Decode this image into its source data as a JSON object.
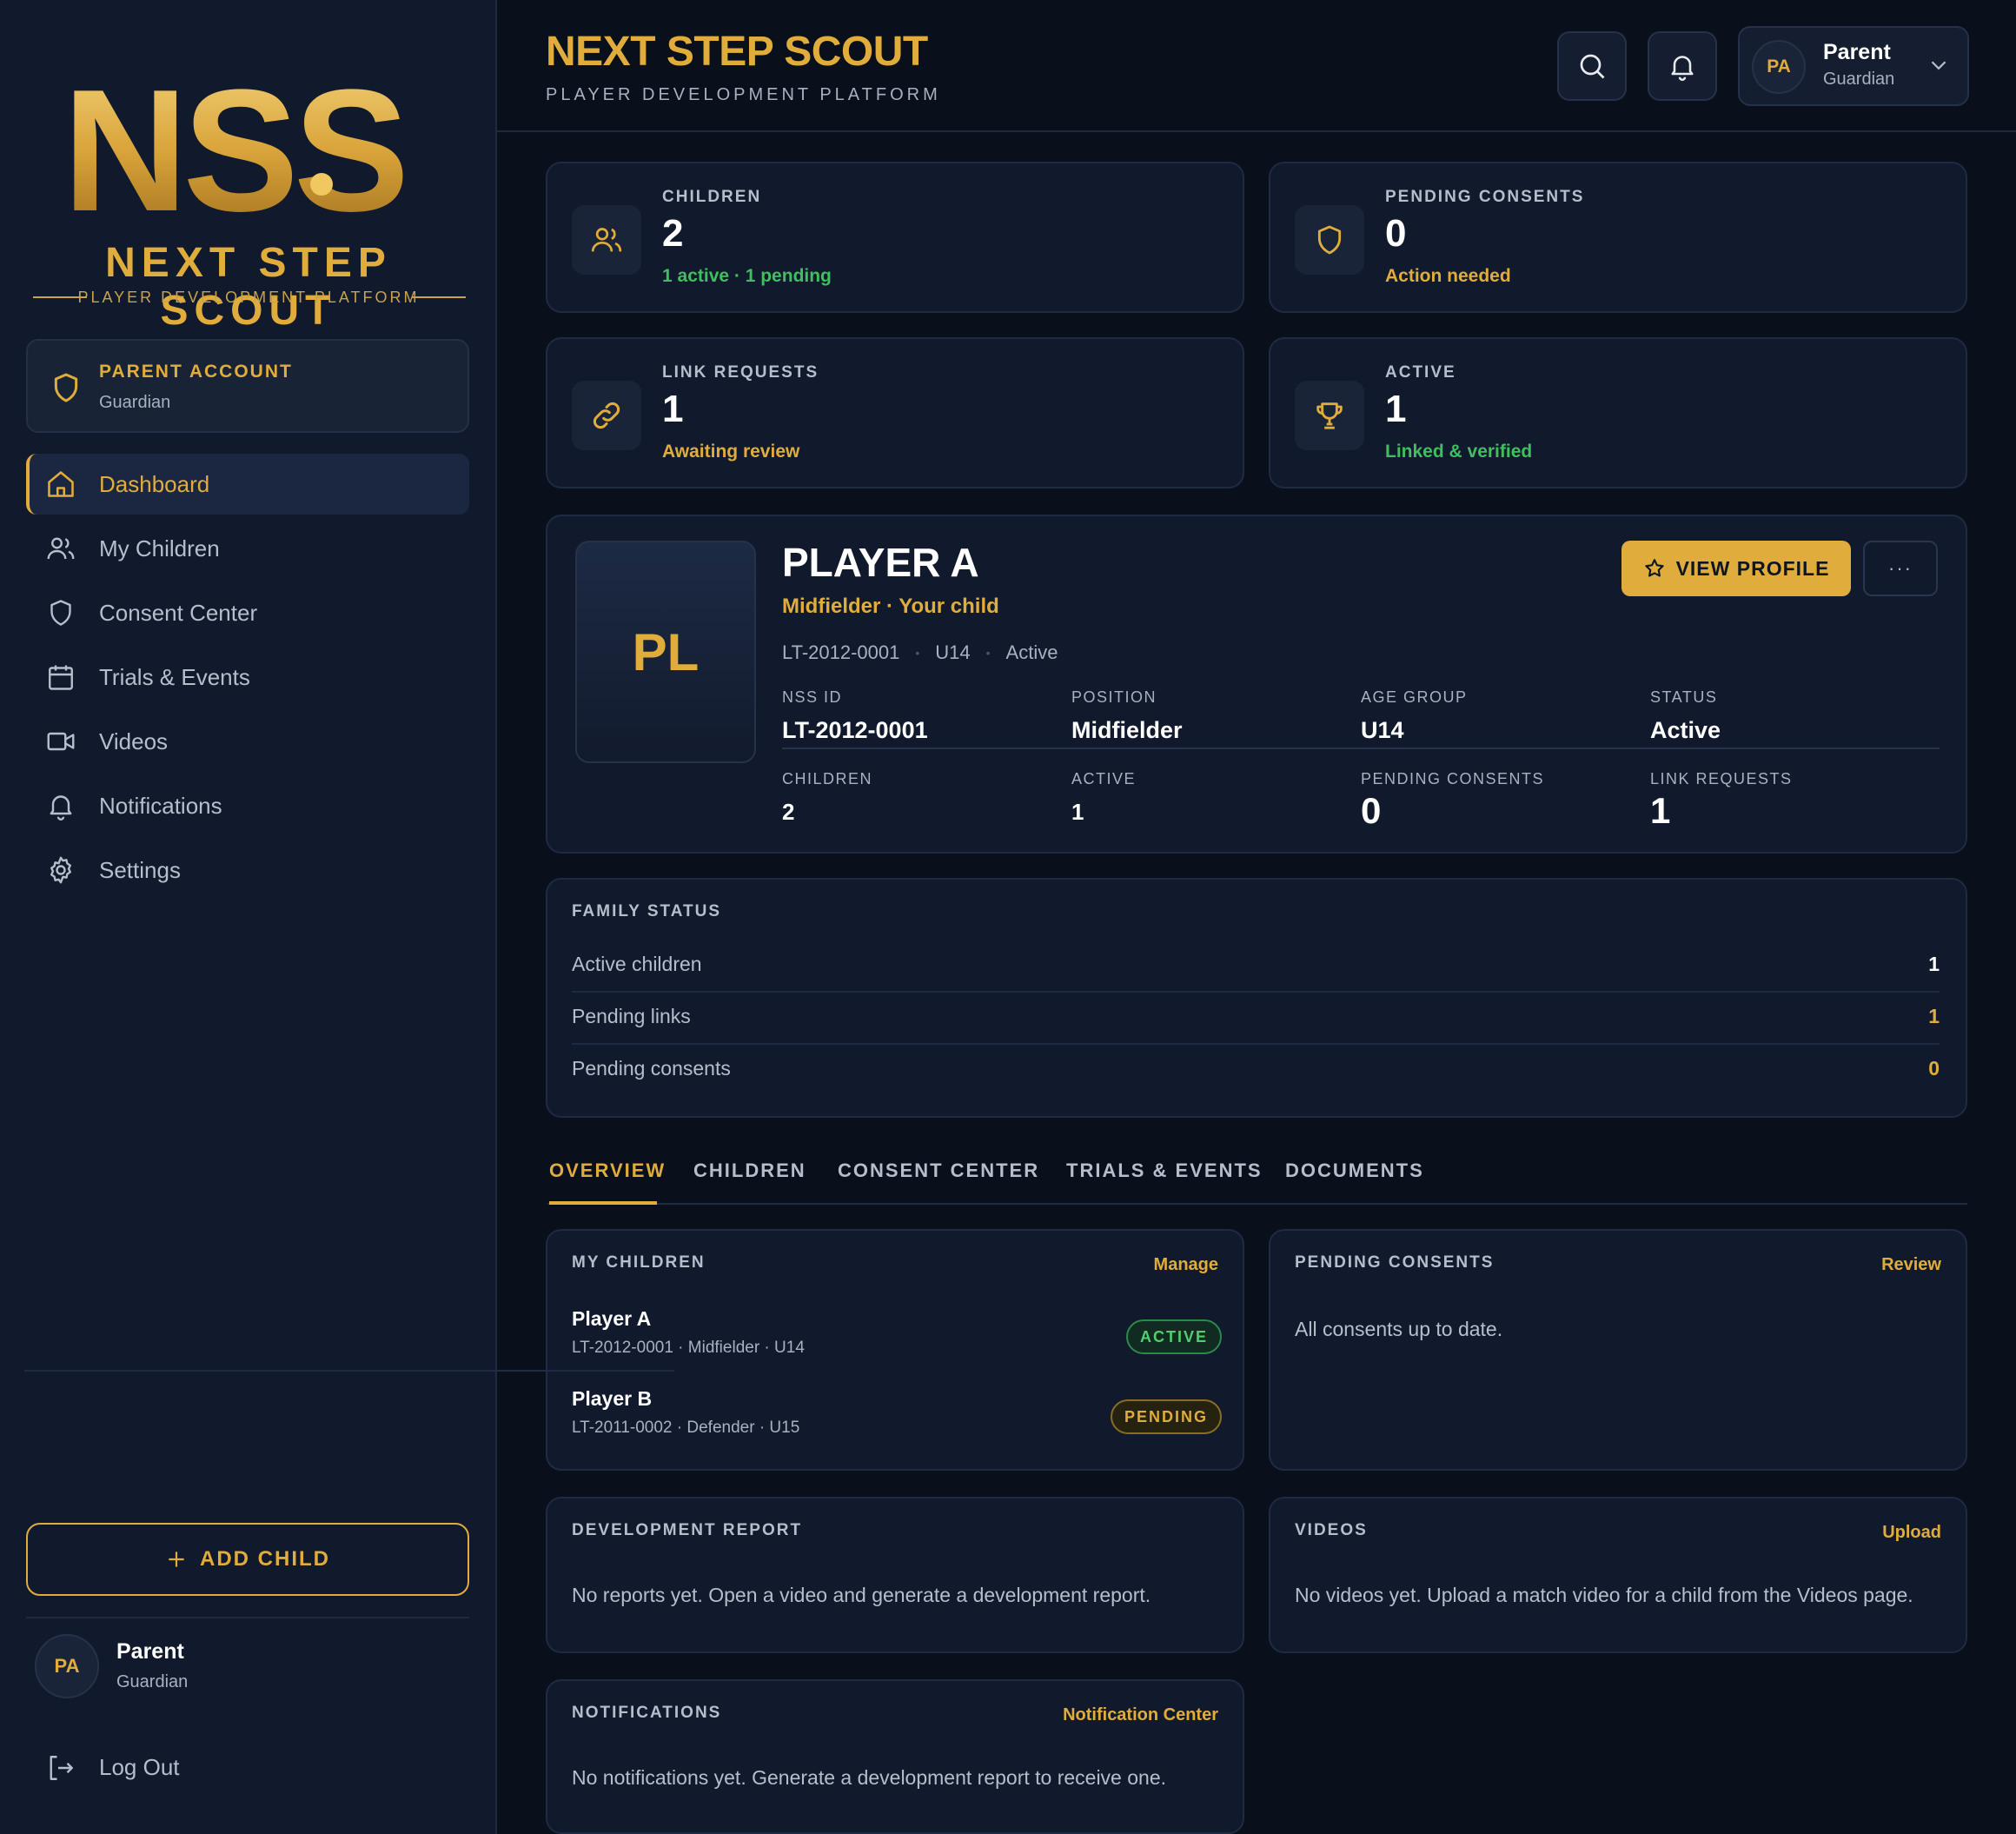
{
  "brand": {
    "logo_mark": "NSS",
    "logo_title": "NEXT STEP SCOUT",
    "logo_subtitle": "PLAYER DEVELOPMENT PLATFORM",
    "accent": "#e0ad3c",
    "success": "#3fbf5e"
  },
  "sidebar": {
    "account": {
      "title": "PARENT ACCOUNT",
      "subtitle": "Guardian",
      "icon": "shield-icon"
    },
    "items": [
      {
        "label": "Dashboard",
        "icon": "home-icon",
        "active": true
      },
      {
        "label": "My Children",
        "icon": "users-icon"
      },
      {
        "label": "Consent Center",
        "icon": "shield-icon"
      },
      {
        "label": "Trials & Events",
        "icon": "calendar-icon"
      },
      {
        "label": "Videos",
        "icon": "video-icon"
      },
      {
        "label": "Notifications",
        "icon": "bell-icon"
      },
      {
        "label": "Settings",
        "icon": "gear-icon"
      }
    ],
    "add_child_label": "ADD CHILD",
    "user": {
      "initials": "PA",
      "name": "Parent",
      "role": "Guardian"
    },
    "logout_label": "Log Out"
  },
  "header": {
    "title": "NEXT STEP SCOUT",
    "subtitle": "PLAYER DEVELOPMENT PLATFORM",
    "profile": {
      "initials": "PA",
      "name": "Parent",
      "role": "Guardian"
    }
  },
  "stats": [
    {
      "label": "CHILDREN",
      "value": "2",
      "sub": "1 active · 1 pending",
      "sub_color": "green",
      "icon": "users-icon"
    },
    {
      "label": "PENDING CONSENTS",
      "value": "0",
      "sub": "Action needed",
      "sub_color": "gold",
      "icon": "shield-icon"
    },
    {
      "label": "LINK REQUESTS",
      "value": "1",
      "sub": "Awaiting review",
      "sub_color": "gold",
      "icon": "link-icon"
    },
    {
      "label": "ACTIVE",
      "value": "1",
      "sub": "Linked & verified",
      "sub_color": "green",
      "icon": "trophy-icon"
    }
  ],
  "player": {
    "initials": "PL",
    "name": "PLAYER A",
    "role": "Midfielder · Your child",
    "meta": [
      "LT-2012-0001",
      "U14",
      "Active"
    ],
    "view_profile_label": "VIEW PROFILE",
    "more_label": "···",
    "fields_row1": [
      {
        "label": "NSS ID",
        "value": "LT-2012-0001"
      },
      {
        "label": "POSITION",
        "value": "Midfielder"
      },
      {
        "label": "AGE GROUP",
        "value": "U14"
      },
      {
        "label": "STATUS",
        "value": "Active"
      }
    ],
    "fields_row2": [
      {
        "label": "CHILDREN",
        "value": "2"
      },
      {
        "label": "ACTIVE",
        "value": "1"
      },
      {
        "label": "PENDING CONSENTS",
        "value": "0"
      },
      {
        "label": "LINK REQUESTS",
        "value": "1"
      }
    ]
  },
  "family_status": {
    "title": "FAMILY STATUS",
    "rows": [
      {
        "label": "Active children",
        "value": "1"
      },
      {
        "label": "Pending links",
        "value": "1"
      },
      {
        "label": "Pending consents",
        "value": "0"
      }
    ]
  },
  "tabs": [
    "OVERVIEW",
    "CHILDREN",
    "CONSENT CENTER",
    "TRIALS & EVENTS",
    "DOCUMENTS"
  ],
  "my_children": {
    "title": "MY CHILDREN",
    "link": "Manage",
    "rows": [
      {
        "name": "Player A",
        "meta": "LT-2012-0001 · Midfielder · U14",
        "badge": "ACTIVE"
      },
      {
        "name": "Player B",
        "meta": "LT-2011-0002 · Defender · U15",
        "badge": "PENDING"
      }
    ]
  },
  "pending_consents": {
    "title": "PENDING CONSENTS",
    "link": "Review",
    "empty": "All consents up to date."
  },
  "dev_report": {
    "title": "DEVELOPMENT REPORT",
    "empty": "No reports yet. Open a video and generate a development report."
  },
  "videos": {
    "title": "VIDEOS",
    "link": "Upload",
    "empty": "No videos yet. Upload a match video for a child from the Videos page."
  },
  "notifications": {
    "title": "NOTIFICATIONS",
    "link": "Notification Center",
    "empty": "No notifications yet. Generate a development report to receive one."
  }
}
